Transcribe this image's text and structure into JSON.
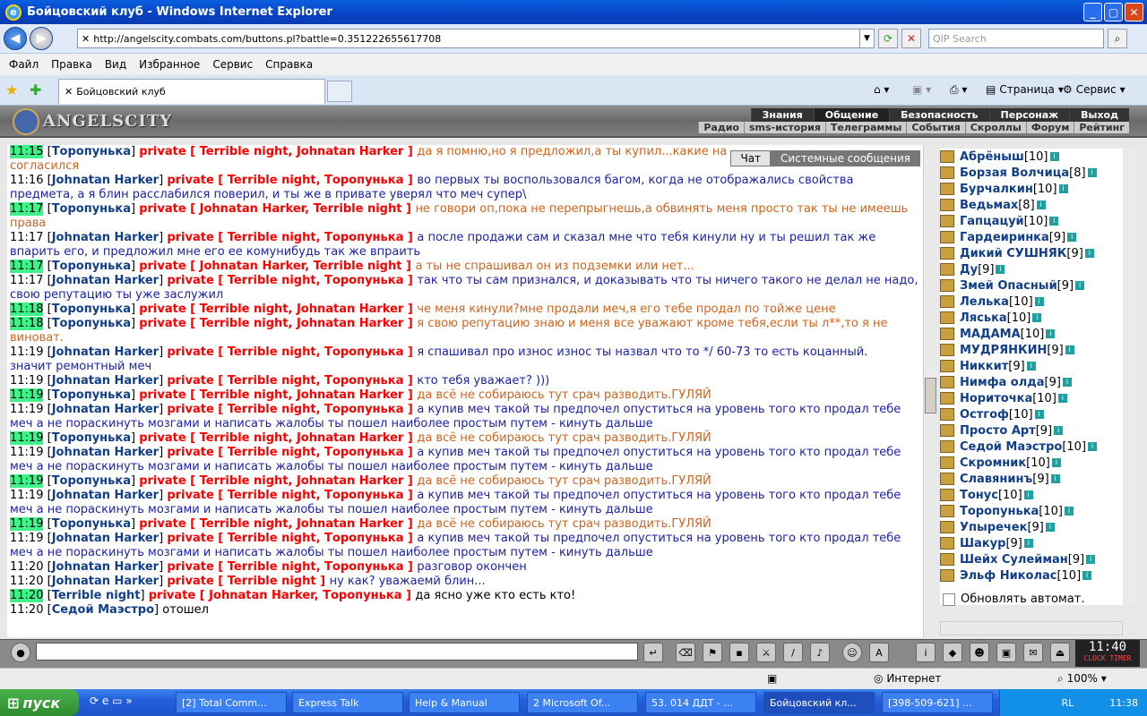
{
  "window": {
    "title": "Бойцовский клуб - Windows Internet Explorer"
  },
  "address": {
    "url": "http://angelscity.combats.com/buttons.pl?battle=0.351222655617708",
    "search_placeholder": "QIP Search"
  },
  "menu": [
    "Файл",
    "Правка",
    "Вид",
    "Избранное",
    "Сервис",
    "Справка"
  ],
  "tab": {
    "title": "Бойцовский клуб"
  },
  "commandbar": {
    "page": "Страница",
    "service": "Сервис"
  },
  "site": {
    "logo": "ANGELSCITY",
    "nav1": [
      "Знания",
      "Общение",
      "Безопасность",
      "Персонаж",
      "Выход"
    ],
    "nav2": [
      "Радио",
      "sms-история",
      "Телеграммы",
      "События",
      "Скроллы",
      "Форум",
      "Рейтинг"
    ]
  },
  "chat_tabs": {
    "chat": "Чат",
    "system": "Системные сообщения"
  },
  "chat": [
    {
      "t": "11:15",
      "hl": true,
      "from": "Торопунька",
      "to": "Terrible night, Johnatan Harker",
      "msg": "да я помню,но я предложил,а ты купил...какие на",
      "cls": "a",
      "cont": "согласился"
    },
    {
      "t": "11:16",
      "hl": false,
      "from": "Johnatan Harker",
      "to": "Terrible night, Торопунька",
      "msg": "во первых ты воспользовался багом, когда не отображались свойства",
      "cls": "b",
      "cont": "предмета, а я блин расслабился поверил, и ты же в привате уверял что меч супер\\"
    },
    {
      "t": "11:17",
      "hl": true,
      "from": "Торопунька",
      "to": "Johnatan Harker, Terrible night",
      "msg": "не говори оп,пока не перепрыгнешь,а обвинять меня просто так ты не имеешь",
      "cls": "a",
      "cont": "права"
    },
    {
      "t": "11:17",
      "hl": false,
      "from": "Johnatan Harker",
      "to": "Terrible night, Торопунька",
      "msg": "а после продажи сам и сказал мне что тебя кинули ну и ты решил так же",
      "cls": "b",
      "cont": "впарить его, и предложил мне его ее комунибудь так же впраить"
    },
    {
      "t": "11:17",
      "hl": true,
      "from": "Торопунька",
      "to": "Johnatan Harker, Terrible night",
      "msg": "а ты не спрашивал он из подземки или нет...",
      "cls": "a",
      "cont": ""
    },
    {
      "t": "11:17",
      "hl": false,
      "from": "Johnatan Harker",
      "to": "Terrible night, Торопунька",
      "msg": "так что ты сам признался, и доказывать что ты ничего такого не делал не надо,",
      "cls": "b",
      "cont": "свою репутацию ты уже заслужил"
    },
    {
      "t": "11:18",
      "hl": true,
      "from": "Торопунька",
      "to": "Terrible night, Johnatan Harker",
      "msg": "че меня кинули?мне продали меч,я его тебе продал по тойже цене",
      "cls": "a",
      "cont": ""
    },
    {
      "t": "11:18",
      "hl": true,
      "from": "Торопунька",
      "to": "Terrible night, Johnatan Harker",
      "msg": "я свою репутацию знаю и меня все уважают кроме тебя,если ты л**,то я не",
      "cls": "a",
      "cont": "виноват."
    },
    {
      "t": "11:19",
      "hl": false,
      "from": "Johnatan Harker",
      "to": "Terrible night, Торопунька",
      "msg": "я спашивал про износ износ ты назвал что то */ 60-73 то есть коцанный.",
      "cls": "b",
      "cont": "значит ремонтный меч"
    },
    {
      "t": "11:19",
      "hl": false,
      "from": "Johnatan Harker",
      "to": "Terrible night, Торопунька",
      "msg": "кто тебя уважает? )))",
      "cls": "b",
      "cont": ""
    },
    {
      "t": "11:19",
      "hl": true,
      "from": "Торопунька",
      "to": "Terrible night, Johnatan Harker",
      "msg": "да всё не собираюсь тут срач разводить.ГУЛЯЙ",
      "cls": "a",
      "cont": ""
    },
    {
      "t": "11:19",
      "hl": false,
      "from": "Johnatan Harker",
      "to": "Terrible night, Торопунька",
      "msg": "а купив меч такой ты предпочел опуститься на уровень того кто продал тебе",
      "cls": "b",
      "cont": "меч а не пораскинуть мозгами и написать жалобы ты пошел наиболее простым путем - кинуть дальше"
    },
    {
      "t": "11:19",
      "hl": true,
      "from": "Торопунька",
      "to": "Terrible night, Johnatan Harker",
      "msg": "да всё не собираюсь тут срач разводить.ГУЛЯЙ",
      "cls": "a",
      "cont": ""
    },
    {
      "t": "11:19",
      "hl": false,
      "from": "Johnatan Harker",
      "to": "Terrible night, Торопунька",
      "msg": "а купив меч такой ты предпочел опуститься на уровень того кто продал тебе",
      "cls": "b",
      "cont": "меч а не пораскинуть мозгами и написать жалобы ты пошел наиболее простым путем - кинуть дальше"
    },
    {
      "t": "11:19",
      "hl": true,
      "from": "Торопунька",
      "to": "Terrible night, Johnatan Harker",
      "msg": "да всё не собираюсь тут срач разводить.ГУЛЯЙ",
      "cls": "a",
      "cont": ""
    },
    {
      "t": "11:19",
      "hl": false,
      "from": "Johnatan Harker",
      "to": "Terrible night, Торопунька",
      "msg": "а купив меч такой ты предпочел опуститься на уровень того кто продал тебе",
      "cls": "b",
      "cont": "меч а не пораскинуть мозгами и написать жалобы ты пошел наиболее простым путем - кинуть дальше"
    },
    {
      "t": "11:19",
      "hl": true,
      "from": "Торопунька",
      "to": "Terrible night, Johnatan Harker",
      "msg": "да всё не собираюсь тут срач разводить.ГУЛЯЙ",
      "cls": "a",
      "cont": ""
    },
    {
      "t": "11:19",
      "hl": false,
      "from": "Johnatan Harker",
      "to": "Terrible night, Торопунька",
      "msg": "а купив меч такой ты предпочел опуститься на уровень того кто продал тебе",
      "cls": "b",
      "cont": "меч а не пораскинуть мозгами и написать жалобы ты пошел наиболее простым путем - кинуть дальше"
    },
    {
      "t": "11:20",
      "hl": false,
      "from": "Johnatan Harker",
      "to": "Terrible night, Торопунька",
      "msg": "разговор окончен",
      "cls": "b",
      "cont": ""
    },
    {
      "t": "11:20",
      "hl": false,
      "from": "Johnatan Harker",
      "to": "Terrible night",
      "msg": "ну как? уважаемй блин...",
      "cls": "b",
      "cont": ""
    },
    {
      "t": "11:20",
      "hl": true,
      "from": "Terrible night",
      "to": "Johnatan Harker, Торопунька",
      "msg": "да ясно уже кто есть кто!",
      "cls": "c",
      "cont": ""
    },
    {
      "t": "11:20",
      "hl": false,
      "from": "Седой Маэстро",
      "to": "",
      "msg": "отошел",
      "cls": "c",
      "cont": ""
    }
  ],
  "users": [
    {
      "name": "Абрёныш",
      "lvl": "[10]"
    },
    {
      "name": "Борзая Волчица",
      "lvl": "[8]"
    },
    {
      "name": "Бурчалкин",
      "lvl": "[10]"
    },
    {
      "name": "Ведьмах",
      "lvl": "[8]"
    },
    {
      "name": "Гапцацуй",
      "lvl": "[10]"
    },
    {
      "name": "Гардеиринка",
      "lvl": "[9]"
    },
    {
      "name": "Дикий СУШНЯК",
      "lvl": "[9]"
    },
    {
      "name": "Ду",
      "lvl": "[9]"
    },
    {
      "name": "Змей Опасный",
      "lvl": "[9]"
    },
    {
      "name": "Лелька",
      "lvl": "[10]"
    },
    {
      "name": "Ляська",
      "lvl": "[10]"
    },
    {
      "name": "МАДАМА",
      "lvl": "[10]"
    },
    {
      "name": "МУДРЯНКИН",
      "lvl": "[9]"
    },
    {
      "name": "Никкит",
      "lvl": "[9]"
    },
    {
      "name": "Нимфа олда",
      "lvl": "[9]"
    },
    {
      "name": "Нориточка",
      "lvl": "[10]"
    },
    {
      "name": "Остгоф",
      "lvl": "[10]"
    },
    {
      "name": "Просто Арт",
      "lvl": "[9]"
    },
    {
      "name": "Седой Маэстро",
      "lvl": "[10]"
    },
    {
      "name": "Скромник",
      "lvl": "[10]"
    },
    {
      "name": "Славянинъ",
      "lvl": "[9]"
    },
    {
      "name": "Тонус",
      "lvl": "[10]"
    },
    {
      "name": "Торопунька",
      "lvl": "[10]"
    },
    {
      "name": "Упыречек",
      "lvl": "[9]"
    },
    {
      "name": "Шакур",
      "lvl": "[9]"
    },
    {
      "name": "Шейх Сулейман",
      "lvl": "[9]"
    },
    {
      "name": "Эльф Николас",
      "lvl": "[10]"
    }
  ],
  "auto_refresh": "Обновлять автомат.",
  "clock": {
    "time": "11:40",
    "label": "CLOCK TIMER"
  },
  "status": {
    "zone": "Интернет",
    "zoom": "100%"
  },
  "taskbar": {
    "start": "пуск",
    "items": [
      "[2] Total Comm...",
      "Express Talk",
      "Help & Manual",
      "2 Microsoft Of...",
      "53. 014 ДДТ - ...",
      "Бойцовский кл...",
      "[398-509-621] ..."
    ],
    "lang": "RL",
    "time": "11:38"
  }
}
